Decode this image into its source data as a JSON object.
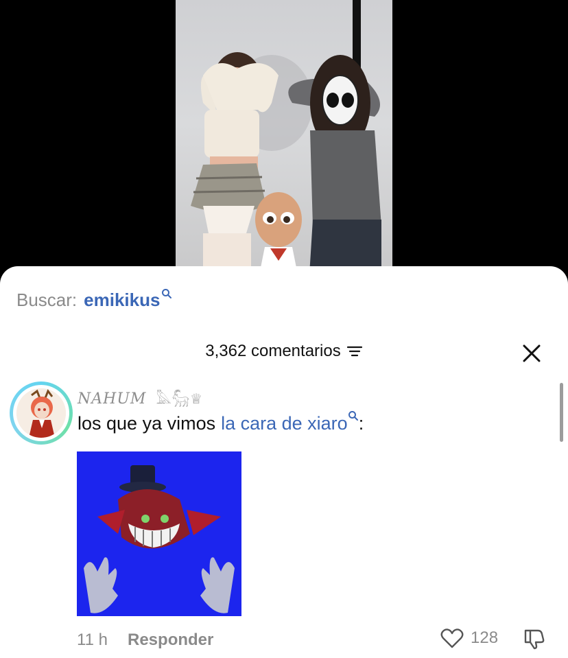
{
  "search": {
    "prefix": "Buscar:",
    "query": "emikikus"
  },
  "comments_header": {
    "count_label": "3,362 comentarios"
  },
  "comment": {
    "username": "NAHUM",
    "username_decor": "𓅓𓃵♕",
    "text": "los que ya vimos",
    "link_text": "la cara de xiaro",
    "trailing": ":",
    "time": "11 h",
    "reply_label": "Responder",
    "like_count": "128"
  },
  "colors": {
    "link": "#3b67b6",
    "muted": "#8a8a8a",
    "avatar_ring": "#6ee0a8",
    "image_bg": "#1c25ee"
  },
  "icons": [
    "search-icon",
    "sort-filter-icon",
    "close-icon",
    "heart-icon",
    "dislike-icon"
  ]
}
